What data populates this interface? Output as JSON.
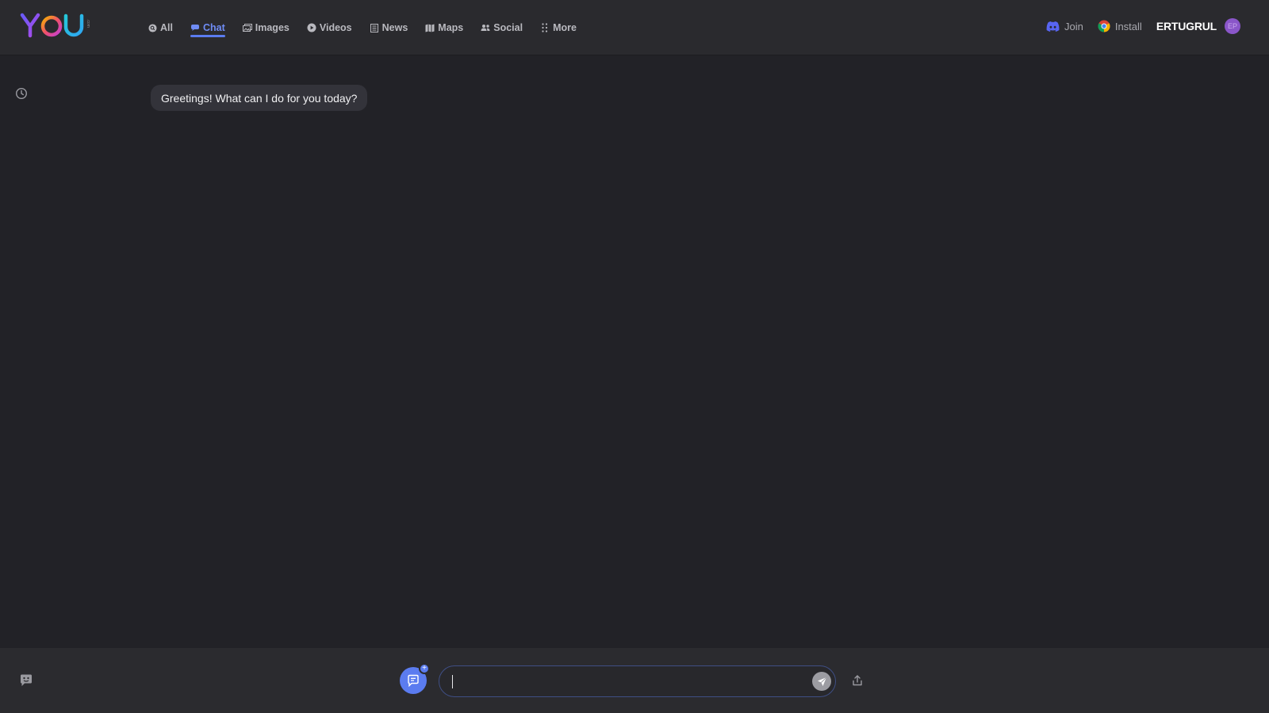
{
  "brand": {
    "logo_text": "YOU",
    "logo_suffix": ".com"
  },
  "nav": {
    "items": [
      {
        "label": "All",
        "icon": "search-circle-icon",
        "active": false
      },
      {
        "label": "Chat",
        "icon": "chat-icon",
        "active": true
      },
      {
        "label": "Images",
        "icon": "images-icon",
        "active": false
      },
      {
        "label": "Videos",
        "icon": "play-icon",
        "active": false
      },
      {
        "label": "News",
        "icon": "news-icon",
        "active": false
      },
      {
        "label": "Maps",
        "icon": "map-icon",
        "active": false
      },
      {
        "label": "Social",
        "icon": "people-icon",
        "active": false
      },
      {
        "label": "More",
        "icon": "grid-dots-icon",
        "active": false
      }
    ]
  },
  "header_right": {
    "join_label": "Join",
    "install_label": "Install",
    "username": "ERTUGRUL",
    "avatar_initials": "EP"
  },
  "chat": {
    "messages": [
      {
        "role": "assistant",
        "text": "Greetings! What can I do for you today?"
      }
    ]
  },
  "composer": {
    "value": "",
    "placeholder": ""
  },
  "colors": {
    "background": "#222227",
    "topbar": "#2a2a2e",
    "accent": "#5b7cf0",
    "bubble": "#33333a",
    "avatar": "#8a56c9"
  }
}
